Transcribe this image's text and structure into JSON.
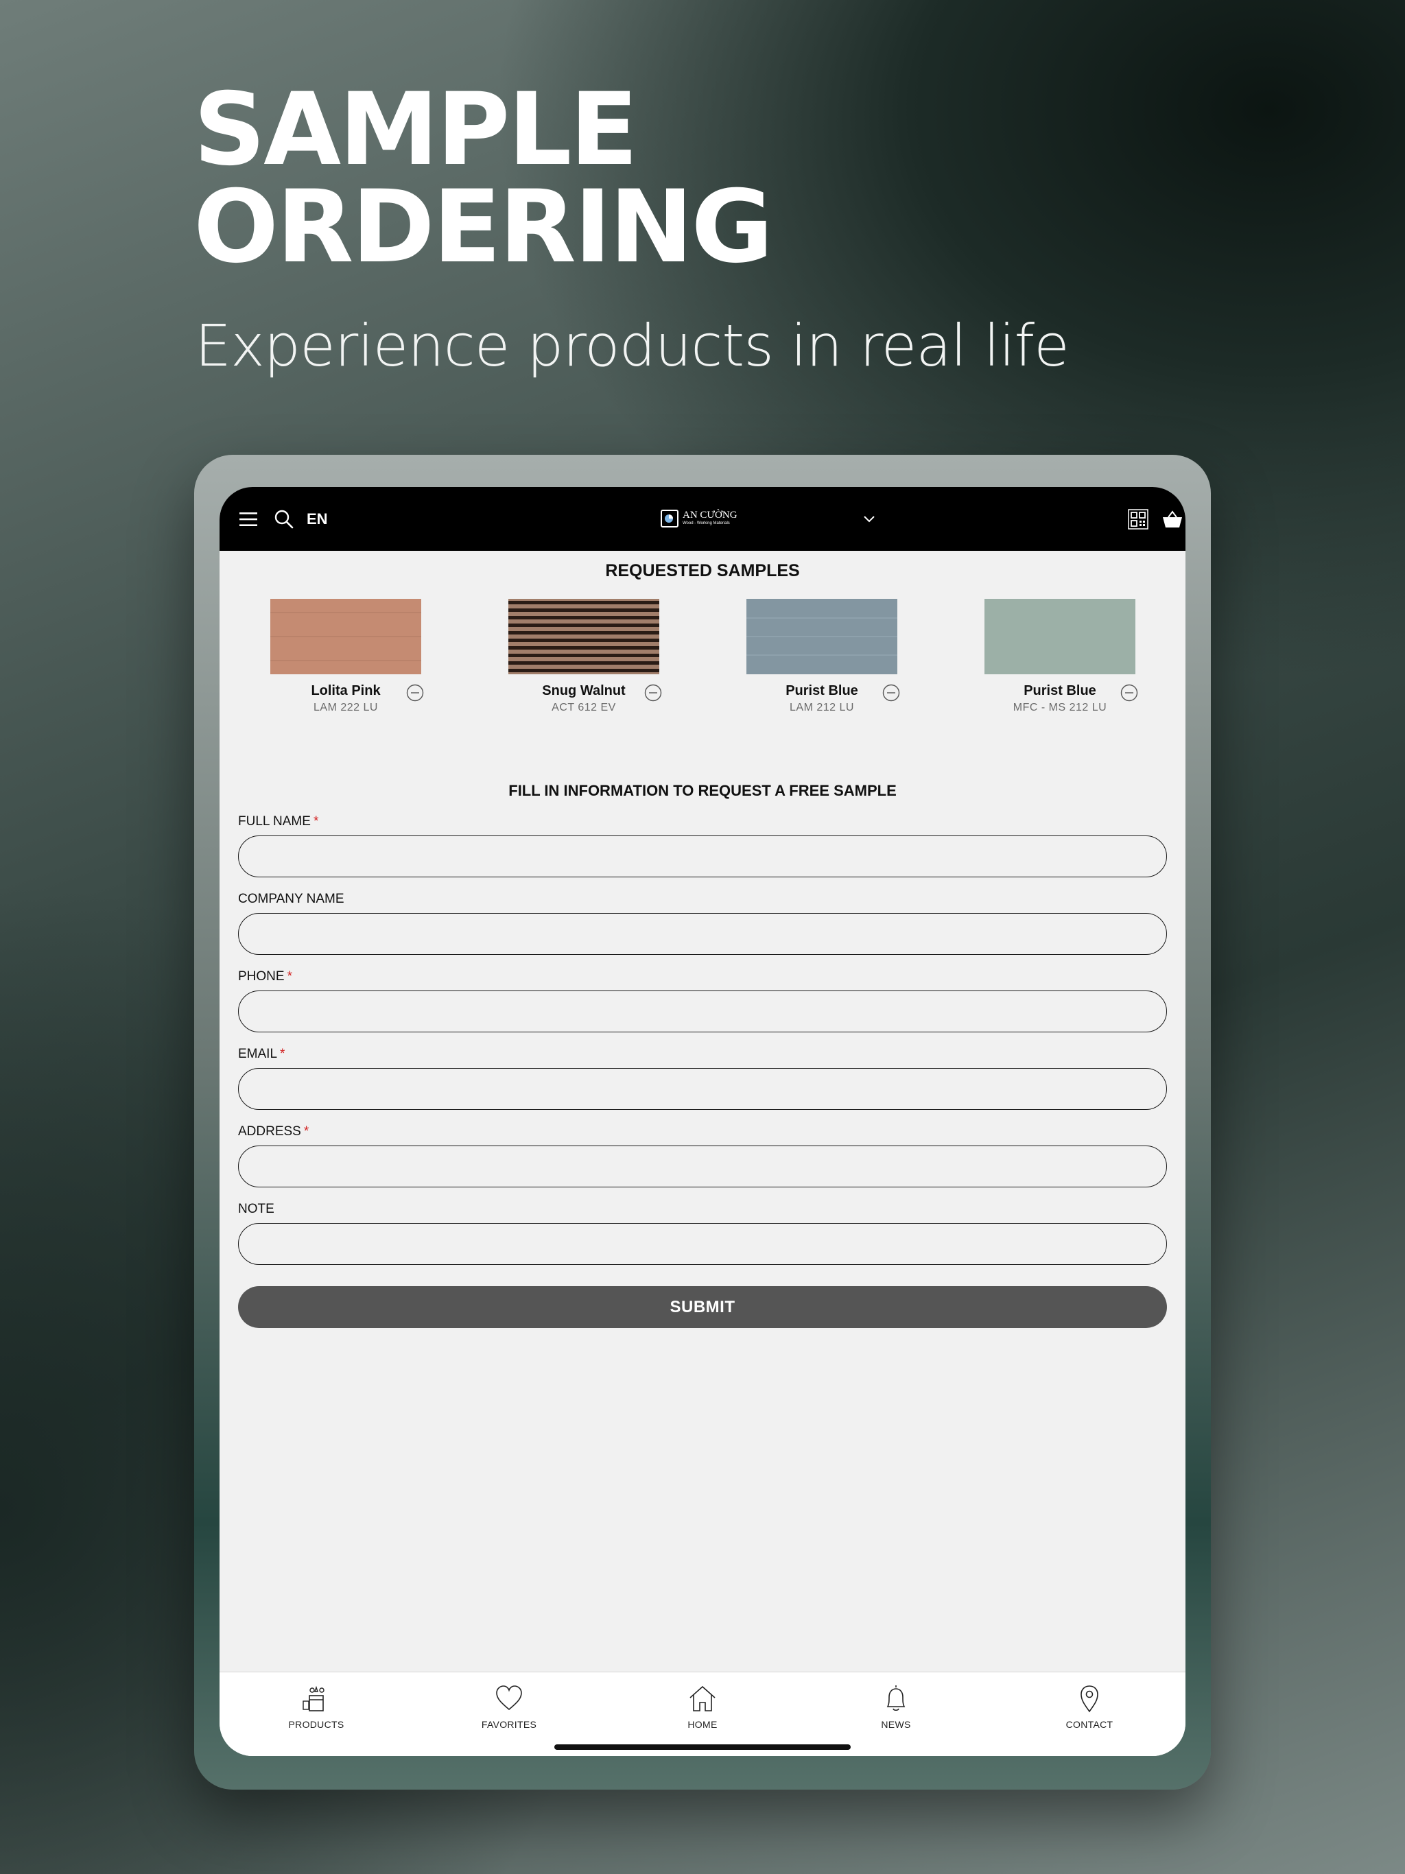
{
  "hero": {
    "title_line1": "SAMPLE",
    "title_line2": "ORDERING",
    "subtitle": "Experience products in real life"
  },
  "topbar": {
    "menu_icon": "hamburger-menu-icon",
    "search_icon": "search-icon",
    "language": "EN",
    "logo_name": "AN CƯỜNG",
    "logo_tagline": "Wood - Working Materials",
    "dropdown_icon": "chevron-down-icon",
    "qr_icon": "qr-code-icon",
    "cart_icon": "basket-icon"
  },
  "samples": {
    "title": "REQUESTED SAMPLES",
    "items": [
      {
        "name": "Lolita Pink",
        "code": "LAM 222 LU",
        "color": "#c58b72"
      },
      {
        "name": "Snug Walnut",
        "code": "ACT 612 EV",
        "color": "#8a6450"
      },
      {
        "name": "Purist Blue",
        "code": "LAM 212 LU",
        "color": "#8396a1"
      },
      {
        "name": "Purist Blue",
        "code": "MFC - MS 212 LU",
        "color": "#9cb0a7"
      }
    ]
  },
  "form": {
    "title": "FILL IN INFORMATION TO REQUEST A FREE SAMPLE",
    "required_mark": "*",
    "fields": {
      "full_name": {
        "label": "FULL NAME",
        "value": "",
        "required": true
      },
      "company_name": {
        "label": "COMPANY NAME",
        "value": "",
        "required": false
      },
      "phone": {
        "label": "PHONE",
        "value": "",
        "required": true
      },
      "email": {
        "label": "EMAIL",
        "value": "",
        "required": true
      },
      "address": {
        "label": "ADDRESS",
        "value": "",
        "required": true
      },
      "note": {
        "label": "NOTE",
        "value": "",
        "required": false
      }
    },
    "submit_label": "SUBMIT",
    "submit_color": "#555555"
  },
  "bottom_nav": {
    "items": [
      {
        "label": "PRODUCTS",
        "icon": "products-icon"
      },
      {
        "label": "FAVORITES",
        "icon": "heart-icon"
      },
      {
        "label": "HOME",
        "icon": "home-icon"
      },
      {
        "label": "NEWS",
        "icon": "bell-icon"
      },
      {
        "label": "CONTACT",
        "icon": "location-pin-icon"
      }
    ]
  }
}
